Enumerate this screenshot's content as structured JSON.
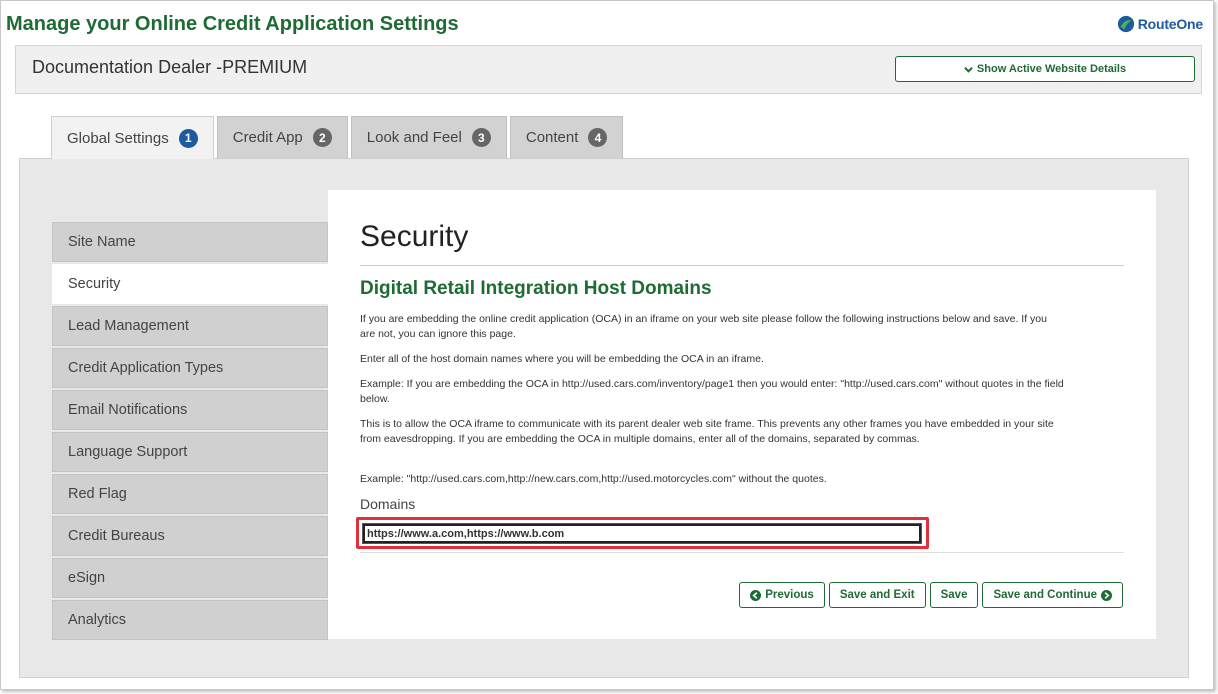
{
  "page": {
    "title": "Manage your Online Credit Application Settings",
    "logo_text": "RouteOne"
  },
  "dealer": {
    "name": "Documentation Dealer -PREMIUM",
    "show_details_label": "Show Active Website Details"
  },
  "tabs": [
    {
      "label": "Global Settings",
      "badge": "1",
      "active": true
    },
    {
      "label": "Credit App",
      "badge": "2",
      "active": false
    },
    {
      "label": "Look and Feel",
      "badge": "3",
      "active": false
    },
    {
      "label": "Content",
      "badge": "4",
      "active": false
    }
  ],
  "sidebar": {
    "items": [
      {
        "label": "Site Name"
      },
      {
        "label": "Security",
        "active": true
      },
      {
        "label": "Lead Management"
      },
      {
        "label": "Credit Application Types"
      },
      {
        "label": "Email Notifications"
      },
      {
        "label": "Language Support"
      },
      {
        "label": "Red Flag"
      },
      {
        "label": "Credit Bureaus"
      },
      {
        "label": "eSign"
      },
      {
        "label": "Analytics"
      }
    ]
  },
  "panel": {
    "heading": "Security",
    "subheading": "Digital Retail Integration Host Domains",
    "paragraphs": [
      "If you are embedding the online credit application (OCA) in an iframe on your web site please follow the following instructions below and save. If you are not, you can ignore this page.",
      "Enter all of the host domain names where you will be embedding the OCA in an iframe.",
      "Example: If you are embedding the OCA in http://used.cars.com/inventory/page1 then you would enter: \"http://used.cars.com\" without quotes in the field below.",
      "This is to allow the OCA iframe to communicate with its parent dealer web site frame. This prevents any other frames you have embedded in your site from eavesdropping. If you are embedding the OCA in multiple domains, enter all of the domains, separated by commas.",
      "Example: \"http://used.cars.com,http://new.cars.com,http://used.motorcycles.com\" without the quotes."
    ],
    "domains_label": "Domains",
    "domains_value": "https://www.a.com,https://www.b.com"
  },
  "buttons": {
    "previous": "Previous",
    "save_exit": "Save and Exit",
    "save": "Save",
    "save_continue": "Save and Continue"
  },
  "colors": {
    "brand_green": "#1e6b34",
    "active_badge": "#1e5aa0",
    "highlight": "#e0303a"
  }
}
